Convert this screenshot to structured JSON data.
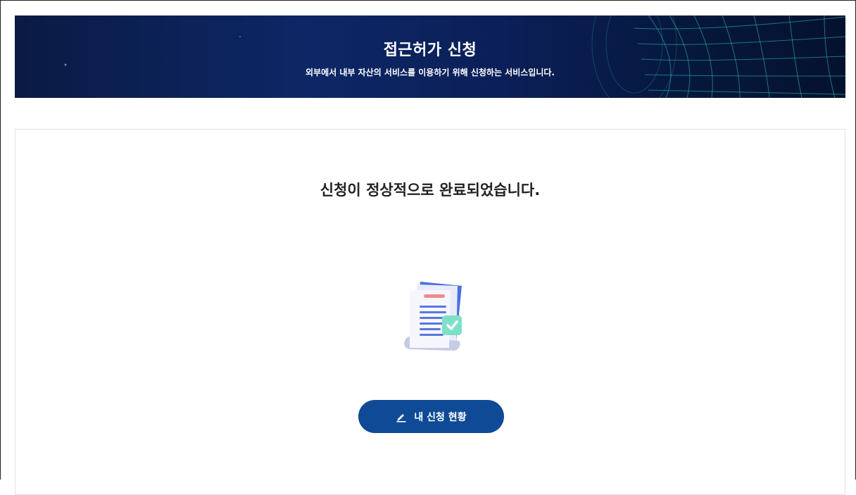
{
  "banner": {
    "title": "접근허가 신청",
    "subtitle": "외부에서 내부 자산의 서비스를 이용하기 위해 신청하는 서비스입니다."
  },
  "result": {
    "message": "신청이 정상적으로 완료되었습니다.",
    "illustration_icon": "document-check-icon"
  },
  "actions": {
    "my_status_label": "내 신청 현황",
    "my_status_icon": "pencil-icon"
  },
  "colors": {
    "banner_bg": "#0b1f57",
    "grid_line": "#2ec7b0",
    "button_bg": "#0f4a96"
  }
}
